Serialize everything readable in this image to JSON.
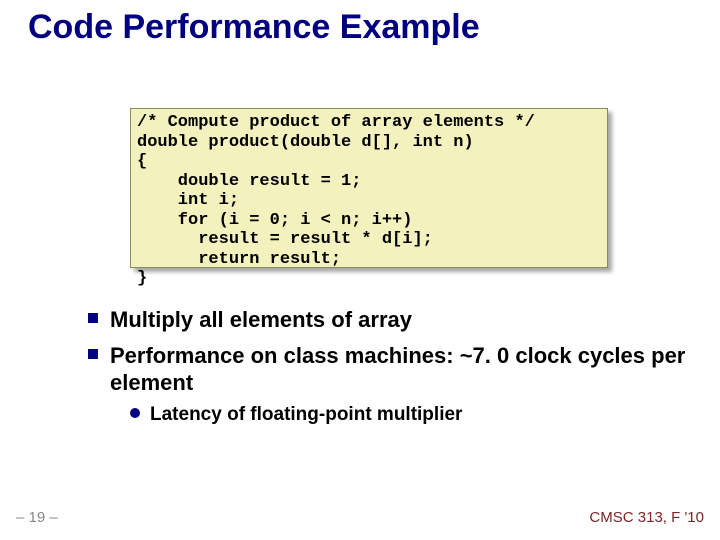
{
  "slide": {
    "title": "Code Performance Example",
    "code": "/* Compute product of array elements */\ndouble product(double d[], int n)\n{\n    double result = 1;\n    int i;\n    for (i = 0; i < n; i++)\n      result = result * d[i];\n      return result;\n}",
    "bullets": {
      "b0": "Multiply all elements of array",
      "b1": "Performance on class machines: ~7. 0 clock cycles per element",
      "sub0": "Latency of floating-point multiplier"
    },
    "footer": {
      "left": "– 19 –",
      "right": "CMSC 313, F '10"
    }
  }
}
